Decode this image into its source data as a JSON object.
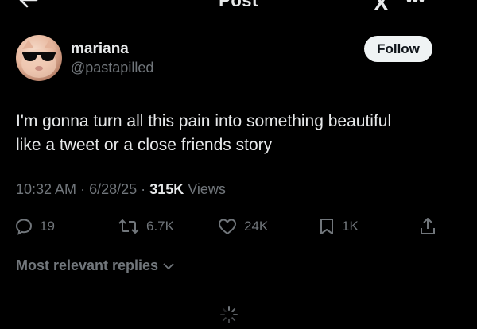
{
  "header": {
    "title": "Post",
    "logo_text": "X",
    "back_icon": "arrow-left-icon",
    "more_icon": "ellipsis-icon"
  },
  "post": {
    "author": {
      "display_name": "mariana",
      "handle": "@pastapilled",
      "avatar": "cat-with-sunglasses"
    },
    "follow_label": "Follow",
    "text_lines": [
      "I'm gonna turn all this pain into something beautiful",
      "like a tweet or a close friends story"
    ],
    "time": "10:32 AM",
    "date": "6/28/25",
    "separator": "·",
    "views_count": "315K",
    "views_label": "Views",
    "actions": {
      "replies": {
        "icon": "reply-icon",
        "count": "19"
      },
      "reposts": {
        "icon": "repost-icon",
        "count": "6.7K"
      },
      "likes": {
        "icon": "heart-icon",
        "count": "24K"
      },
      "bookmarks": {
        "icon": "bookmark-icon",
        "count": "1K"
      },
      "share": {
        "icon": "share-icon"
      }
    }
  },
  "replies": {
    "sort_label": "Most relevant replies"
  },
  "colors": {
    "background": "#000000",
    "text_primary": "#e7e9ea",
    "text_secondary": "#71767b",
    "follow_bg": "#eff3f4"
  }
}
